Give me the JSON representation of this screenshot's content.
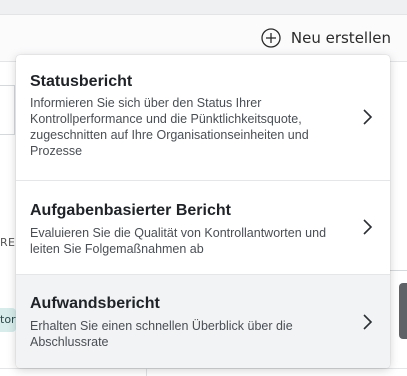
{
  "toolbar": {
    "new_button_label": "Neu erstellen",
    "new_button_icon": "plus-circle-icon"
  },
  "background": {
    "partial_text_re": "RE",
    "partial_chip_text": "tor"
  },
  "menu": {
    "items": [
      {
        "title": "Statusbericht",
        "description": "Informieren Sie sich über den Status Ihrer Kontrollperformance und die Pünktlichkeitsquote, zugeschnitten auf Ihre Organisationseinheiten und Prozesse",
        "icon": "chevron-right-icon"
      },
      {
        "title": "Aufgabenbasierter Bericht",
        "description": "Evaluieren Sie die Qualität von Kontrollantworten und leiten Sie Folgemaßnahmen ab",
        "icon": "chevron-right-icon"
      },
      {
        "title": "Aufwandsbericht",
        "description": "Erhalten Sie einen schnellen Überblick über die Abschlussrate",
        "icon": "chevron-right-icon",
        "hovered": true
      }
    ]
  },
  "colors": {
    "menu_background": "#ffffff",
    "hover_background": "#f2f3f4",
    "title_text": "#1f2327",
    "description_text": "#4a4f55",
    "scrollbar": "#5f6368"
  }
}
